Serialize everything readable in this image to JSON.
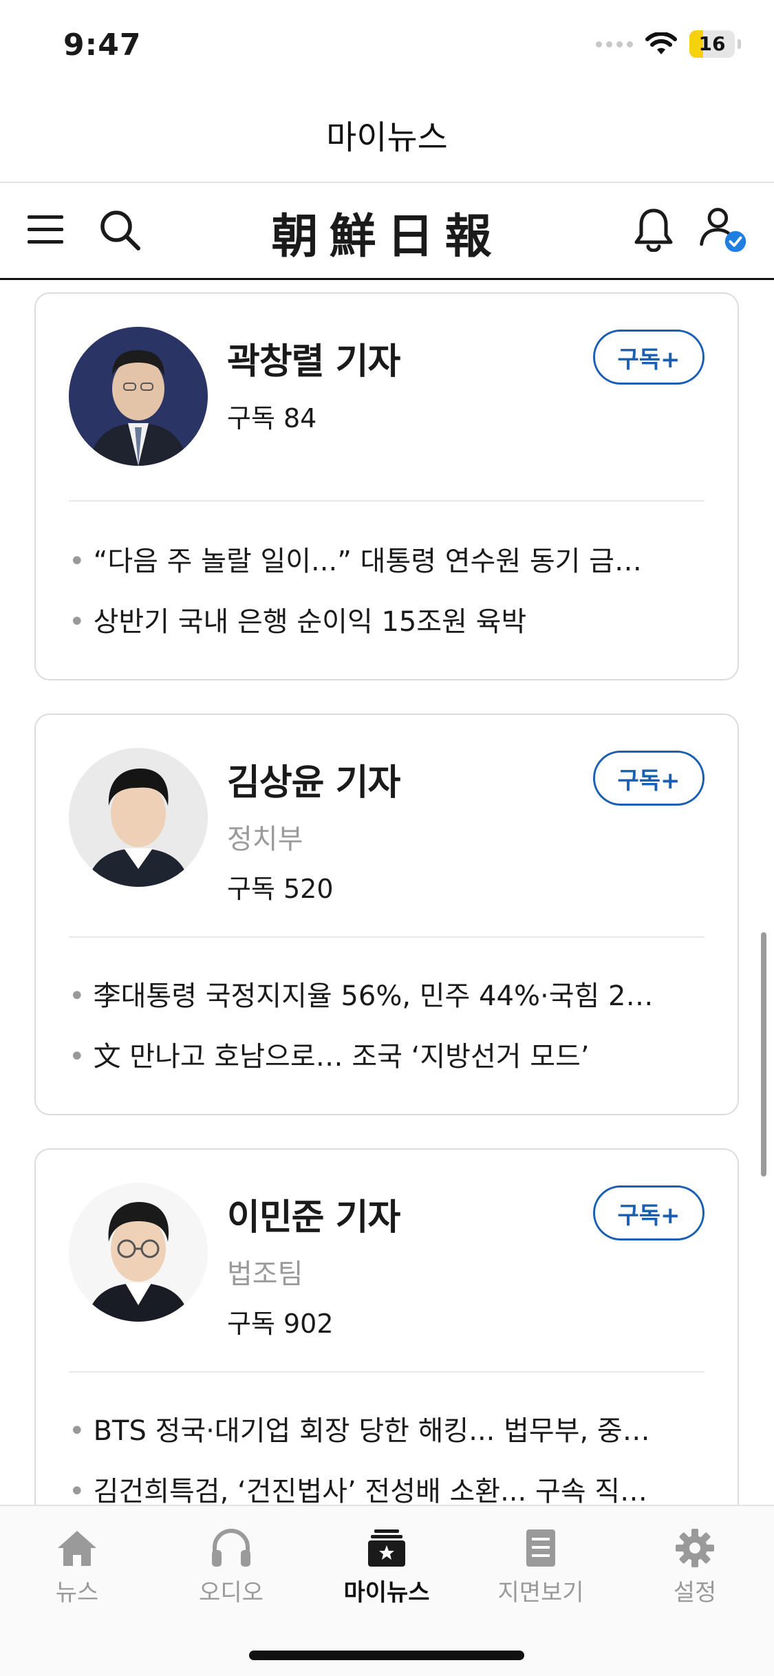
{
  "status_bar": {
    "time": "9:47",
    "battery": "16"
  },
  "header": {
    "title": "마이뉴스"
  },
  "toolbar": {
    "logo": "朝鮮日報"
  },
  "reporters": [
    {
      "name": "곽창렬 기자",
      "dept": "",
      "subscribers": "구독 84",
      "subscribe_label": "구독+",
      "articles": [
        "“다음 주 놀랄 일이...” 대통령 연수원 동기 금…",
        "상반기 국내 은행 순이익 15조원 육박"
      ]
    },
    {
      "name": "김상윤 기자",
      "dept": "정치부",
      "subscribers": "구독 520",
      "subscribe_label": "구독+",
      "articles": [
        "李대통령 국정지지율 56%, 민주 44%·국힘 2…",
        "文 만나고 호남으로… 조국 ‘지방선거 모드’"
      ]
    },
    {
      "name": "이민준 기자",
      "dept": "법조팀",
      "subscribers": "구독 902",
      "subscribe_label": "구독+",
      "articles": [
        "BTS 정국·대기업 회장 당한 해킹... 법무부, 중…",
        "김건희특검, ‘건진법사’ 전성배 소환... 구속 직…"
      ]
    }
  ],
  "tabs": [
    {
      "label": "뉴스",
      "icon": "home-icon"
    },
    {
      "label": "오디오",
      "icon": "headphones-icon"
    },
    {
      "label": "마이뉴스",
      "icon": "mynews-icon",
      "active": true
    },
    {
      "label": "지면보기",
      "icon": "document-icon"
    },
    {
      "label": "설정",
      "icon": "gear-icon"
    }
  ],
  "colors": {
    "accent": "#1a5fb4",
    "muted": "#9a9a9a"
  }
}
